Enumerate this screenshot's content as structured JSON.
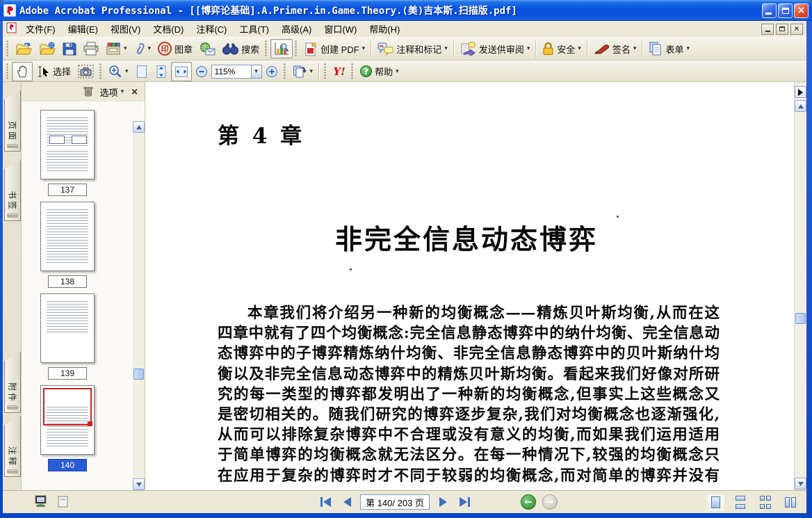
{
  "window": {
    "title": "Adobe Acrobat Professional - [[博弈论基础].A.Primer.in.Game.Theory.(美)吉本斯.扫描版.pdf]"
  },
  "icons": {
    "dropdown": "▾",
    "close_x": "×",
    "stamp_char": "印",
    "question_mark": "?",
    "back_arrow": "←",
    "forward_arrow": "→"
  },
  "menu_bar": {
    "items": [
      "文件(F)",
      "编辑(E)",
      "视图(V)",
      "文档(D)",
      "注释(C)",
      "工具(T)",
      "高级(A)",
      "窗口(W)",
      "帮助(H)"
    ]
  },
  "toolbar_file": {
    "stamp_label": "图章",
    "search_label": "搜索",
    "create_pdf_label": "创建 PDF",
    "comment_markup_label": "注释和标记",
    "send_review_label": "发送供审阅",
    "secure_label": "安全",
    "sign_label": "签名",
    "forms_label": "表单"
  },
  "toolbar_view": {
    "select_label": "选择",
    "zoom_value": "115%",
    "yahoo_label": "Y!",
    "help_label": "帮助"
  },
  "sidebar": {
    "tabs": [
      "页面",
      "书签",
      "附件",
      "注释"
    ],
    "options_label": "选项",
    "thumbnails": [
      {
        "page": "137",
        "selected": false
      },
      {
        "page": "138",
        "selected": false
      },
      {
        "page": "139",
        "selected": false
      },
      {
        "page": "140",
        "selected": true
      }
    ]
  },
  "document": {
    "chapter_heading": "第 4 章",
    "title": "非完全信息动态博弈",
    "body_lines": [
      "本章我们将介绍另一种新的均衡概念——精炼贝叶斯均衡,从而在这",
      "四章中就有了四个均衡概念:完全信息静态博弈中的纳什均衡、完全信息动",
      "态博弈中的子博弈精炼纳什均衡、非完全信息静态博弈中的贝叶斯纳什均",
      "衡以及非完全信息动态博弈中的精炼贝叶斯均衡。看起来我们好像对所研",
      "究的每一类型的博弈都发明出了一种新的均衡概念,但事实上这些概念又",
      "是密切相关的。随我们研究的博弈逐步复杂,我们对均衡概念也逐渐强化,",
      "从而可以排除复杂博弈中不合理或没有意义的均衡,而如果我们运用适用",
      "于简单博弈的均衡概念就无法区分。在每一种情况下,较强的均衡概念只",
      "在应用于复杂的博弈时才不同于较弱的均衡概念,而对简单的博弈并没有"
    ]
  },
  "status_bar": {
    "page_field": "第 140/ 203 页"
  },
  "colors": {
    "titlebar_blue": "#0054E3",
    "chrome_beige": "#ECE9D8",
    "selection_blue": "#2A5BD7",
    "current_page_outline": "#CC2222"
  }
}
